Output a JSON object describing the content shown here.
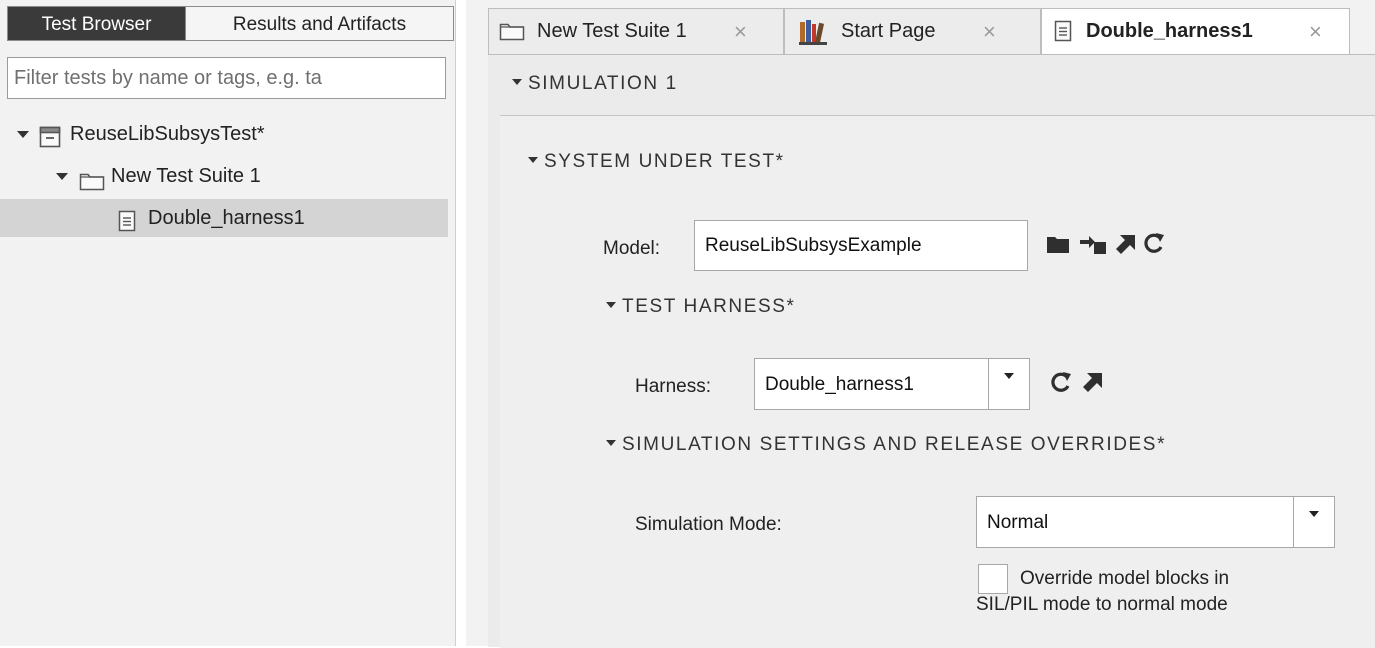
{
  "left_panel": {
    "tabs": [
      "Test Browser",
      "Results and Artifacts"
    ],
    "filter_placeholder": "Filter tests by name or tags, e.g. ta",
    "tree": [
      {
        "label": "ReuseLibSubsysTest*",
        "icon": "test-file-icon",
        "level": 0
      },
      {
        "label": "New Test Suite 1",
        "icon": "folder-icon",
        "level": 1
      },
      {
        "label": "Double_harness1",
        "icon": "document-icon",
        "level": 2,
        "selected": true
      }
    ]
  },
  "doc_tabs": [
    {
      "label": "New Test Suite 1",
      "icon": "folder-icon",
      "close": "×"
    },
    {
      "label": "Start Page",
      "icon": "library-icon",
      "close": "×"
    },
    {
      "label": "Double_harness1",
      "icon": "document-icon",
      "close": "×",
      "active": true
    }
  ],
  "sections": {
    "simulation": "SIMULATION 1",
    "system_under_test": "SYSTEM UNDER TEST*",
    "test_harness": "TEST HARNESS*",
    "sim_settings": "SIMULATION SETTINGS AND RELEASE OVERRIDES*"
  },
  "model": {
    "label": "Model:",
    "value": "ReuseLibSubsysExample",
    "icons": [
      "folder-open-icon",
      "create-harness-icon",
      "open-model-icon",
      "refresh-icon"
    ]
  },
  "harness": {
    "label": "Harness:",
    "value": "Double_harness1",
    "icons": [
      "refresh-icon",
      "open-model-icon"
    ]
  },
  "simulation_mode": {
    "label": "Simulation Mode:",
    "value": "Normal"
  },
  "override_checkbox": {
    "line1": "Override model blocks in",
    "line2": "SIL/PIL mode to normal mode",
    "checked": false
  },
  "colors": {
    "active_tab_bg": "#3a3a3a",
    "panel_bg": "#f2f2f2",
    "selected_row": "#d4d4d4"
  }
}
